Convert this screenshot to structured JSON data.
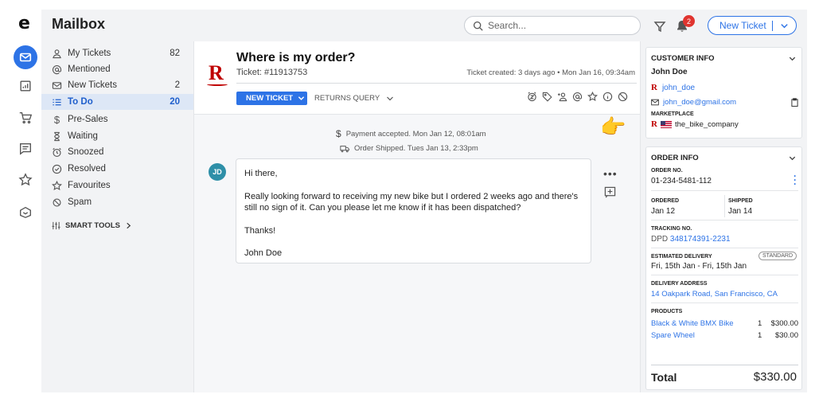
{
  "rail": {
    "logo": "e"
  },
  "header": {
    "app_title": "Mailbox",
    "search_placeholder": "Search...",
    "notification_count": "2",
    "new_ticket_label": "New Ticket"
  },
  "sidebar": {
    "items": [
      {
        "label": "My Tickets",
        "count": "82",
        "icon": "user-icon"
      },
      {
        "label": "Mentioned",
        "count": "",
        "icon": "at-icon"
      },
      {
        "label": "New Tickets",
        "count": "2",
        "icon": "envelope-icon"
      },
      {
        "label": "To Do",
        "count": "20",
        "icon": "list-icon"
      },
      {
        "label": "Pre-Sales",
        "count": "",
        "icon": "dollar-icon"
      },
      {
        "label": "Waiting",
        "count": "",
        "icon": "hourglass-icon"
      },
      {
        "label": "Snoozed",
        "count": "",
        "icon": "alarm-icon"
      },
      {
        "label": "Resolved",
        "count": "",
        "icon": "check-circle-icon"
      },
      {
        "label": "Favourites",
        "count": "",
        "icon": "star-icon"
      },
      {
        "label": "Spam",
        "count": "",
        "icon": "block-icon"
      }
    ],
    "smart_tools": "SMART TOOLS"
  },
  "ticket": {
    "brand_logo": "R",
    "title": "Where is my order?",
    "number": "Ticket: #11913753",
    "created": "Ticket created: 3 days ago  •  Mon Jan 16, 09:34am",
    "new_ticket_btn": "NEW TICKET",
    "returns_query": "RETURNS QUERY",
    "events": [
      "Payment accepted. Mon Jan 12, 08:01am",
      "Order Shipped. Tues Jan 13, 2:33pm"
    ],
    "avatar": "JD",
    "message": {
      "greeting": "Hi there,",
      "body": "Really looking forward to receiving my new bike but I ordered 2 weeks ago and there's still no sign of it. Can you please let me know if it has been dispatched?",
      "thanks": "Thanks!",
      "signature": "John Doe"
    }
  },
  "customer": {
    "section_title": "CUSTOMER INFO",
    "name": "John Doe",
    "username": "john_doe",
    "email": "john_doe@gmail.com",
    "marketplace_label": "MARKETPLACE",
    "marketplace": "the_bike_company"
  },
  "order": {
    "section_title": "ORDER INFO",
    "order_no_label": "ORDER NO.",
    "order_no": "01-234-5481-112",
    "ordered_label": "ORDERED",
    "ordered": "Jan 12",
    "shipped_label": "SHIPPED",
    "shipped": "Jan 14",
    "tracking_label": "TRACKING NO.",
    "carrier": "DPD",
    "tracking_no": "348174391-2231",
    "est_delivery_label": "ESTIMATED DELIVERY",
    "est_delivery": "Fri, 15th Jan - Fri, 15th Jan",
    "shipping_type": "STANDARD",
    "address_label": "DELIVERY ADDRESS",
    "address": "14 Oakpark Road, San Francisco, CA",
    "products_label": "PRODUCTS",
    "products": [
      {
        "name": "Black & White BMX Bike",
        "qty": "1",
        "price": "$300.00"
      },
      {
        "name": "Spare Wheel",
        "qty": "1",
        "price": "$30.00"
      }
    ],
    "total_label": "Total",
    "total": "$330.00"
  },
  "colors": {
    "accent": "#2d73e6",
    "brand": "#bf0000",
    "badge": "#e0342f",
    "avatar": "#2e8fa8"
  }
}
